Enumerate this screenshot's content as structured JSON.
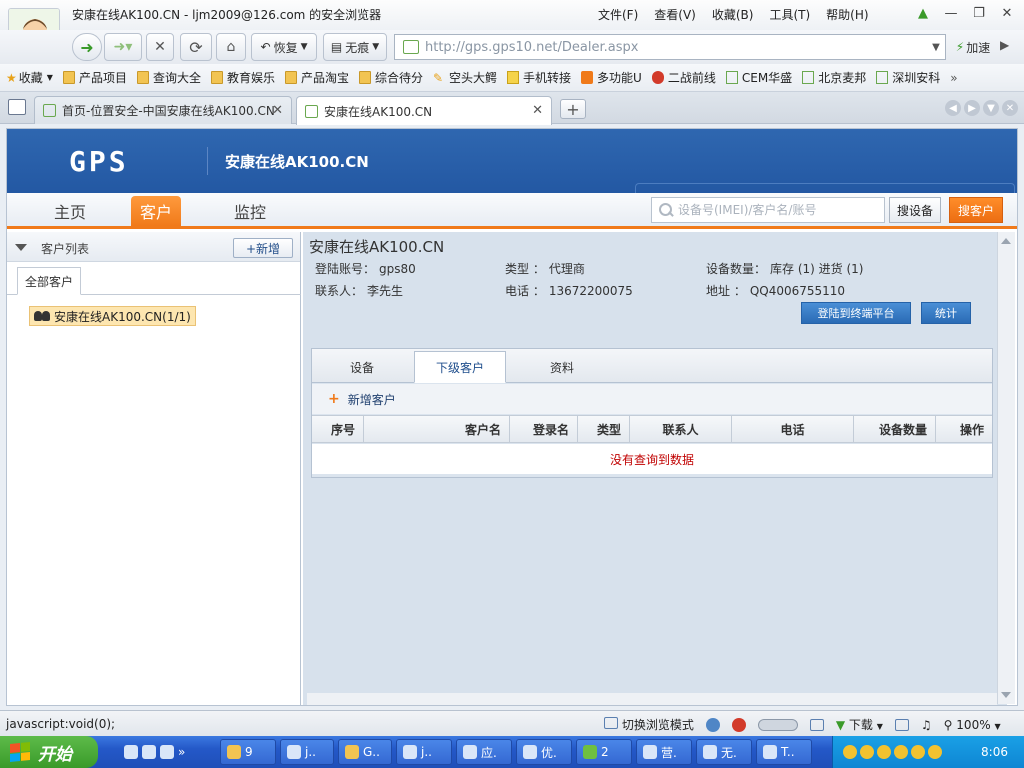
{
  "browser": {
    "window_title": "安康在线AK100.CN - ljm2009@126.com 的安全浏览器",
    "menus": [
      "文件(F)",
      "查看(V)",
      "收藏(B)",
      "工具(T)",
      "帮助(H)"
    ],
    "restore_label": "恢复",
    "noscar_label": "无痕",
    "url": "http://gps.gps10.net/Dealer.aspx",
    "speed_label": "加速",
    "bookmarks": [
      "收藏",
      "产品项目",
      "查询大全",
      "教育娱乐",
      "产品淘宝",
      "综合待分",
      "空头大鳄",
      "手机转接",
      "多功能U",
      "二战前线",
      "CEM华盛",
      "北京麦邦",
      "深圳安科"
    ],
    "tabs": [
      {
        "title": "首页-位置安全-中国安康在线AK100.CN",
        "active": false
      },
      {
        "title": "安康在线AK100.CN",
        "active": true
      }
    ]
  },
  "site": {
    "logo": "GPS",
    "title": "安康在线AK100.CN",
    "nav": {
      "home": "主页",
      "customer": "客户",
      "monitor": "监控"
    },
    "search_placeholder": "设备号(IMEI)/客户名/账号",
    "search_device": "搜设备",
    "search_customer": "搜客户"
  },
  "left": {
    "header": "客户列表",
    "add_button": "+新增",
    "tab": "全部客户",
    "tree_item": "安康在线AK100.CN(1/1)"
  },
  "right": {
    "title": "安康在线AK100.CN",
    "login_label": "登陆账号：",
    "login_value": "gps80",
    "type_label": "类型 ：",
    "type_value": "代理商",
    "devices_label": "设备数量：",
    "devices_value": "库存 (1)  进货 (1)",
    "contact_label": "联系人：",
    "contact_value": "李先生",
    "phone_label": "电话 ：",
    "phone_value": "13672200075",
    "address_label": "地址 ：",
    "address_value": "QQ4006755110",
    "btn_login_terminal": "登陆到终端平台",
    "btn_stats": "统计",
    "tabs": [
      "设备",
      "下级客户",
      "资料"
    ],
    "add_customer": "新增客户",
    "columns": [
      "序号",
      "客户名",
      "登录名",
      "类型",
      "联系人",
      "电话",
      "设备数量",
      "操作"
    ],
    "empty_message": "没有查询到数据"
  },
  "status": {
    "left": "javascript:void(0);",
    "switch_mode": "切换浏览模式",
    "download": "下载",
    "zoom": "100%"
  },
  "taskbar": {
    "start": "开始",
    "items": [
      "9",
      "j..",
      "G..",
      "j..",
      "应.",
      "优.",
      "2",
      "营.",
      "无.",
      "T.."
    ],
    "clock": "8:06"
  }
}
